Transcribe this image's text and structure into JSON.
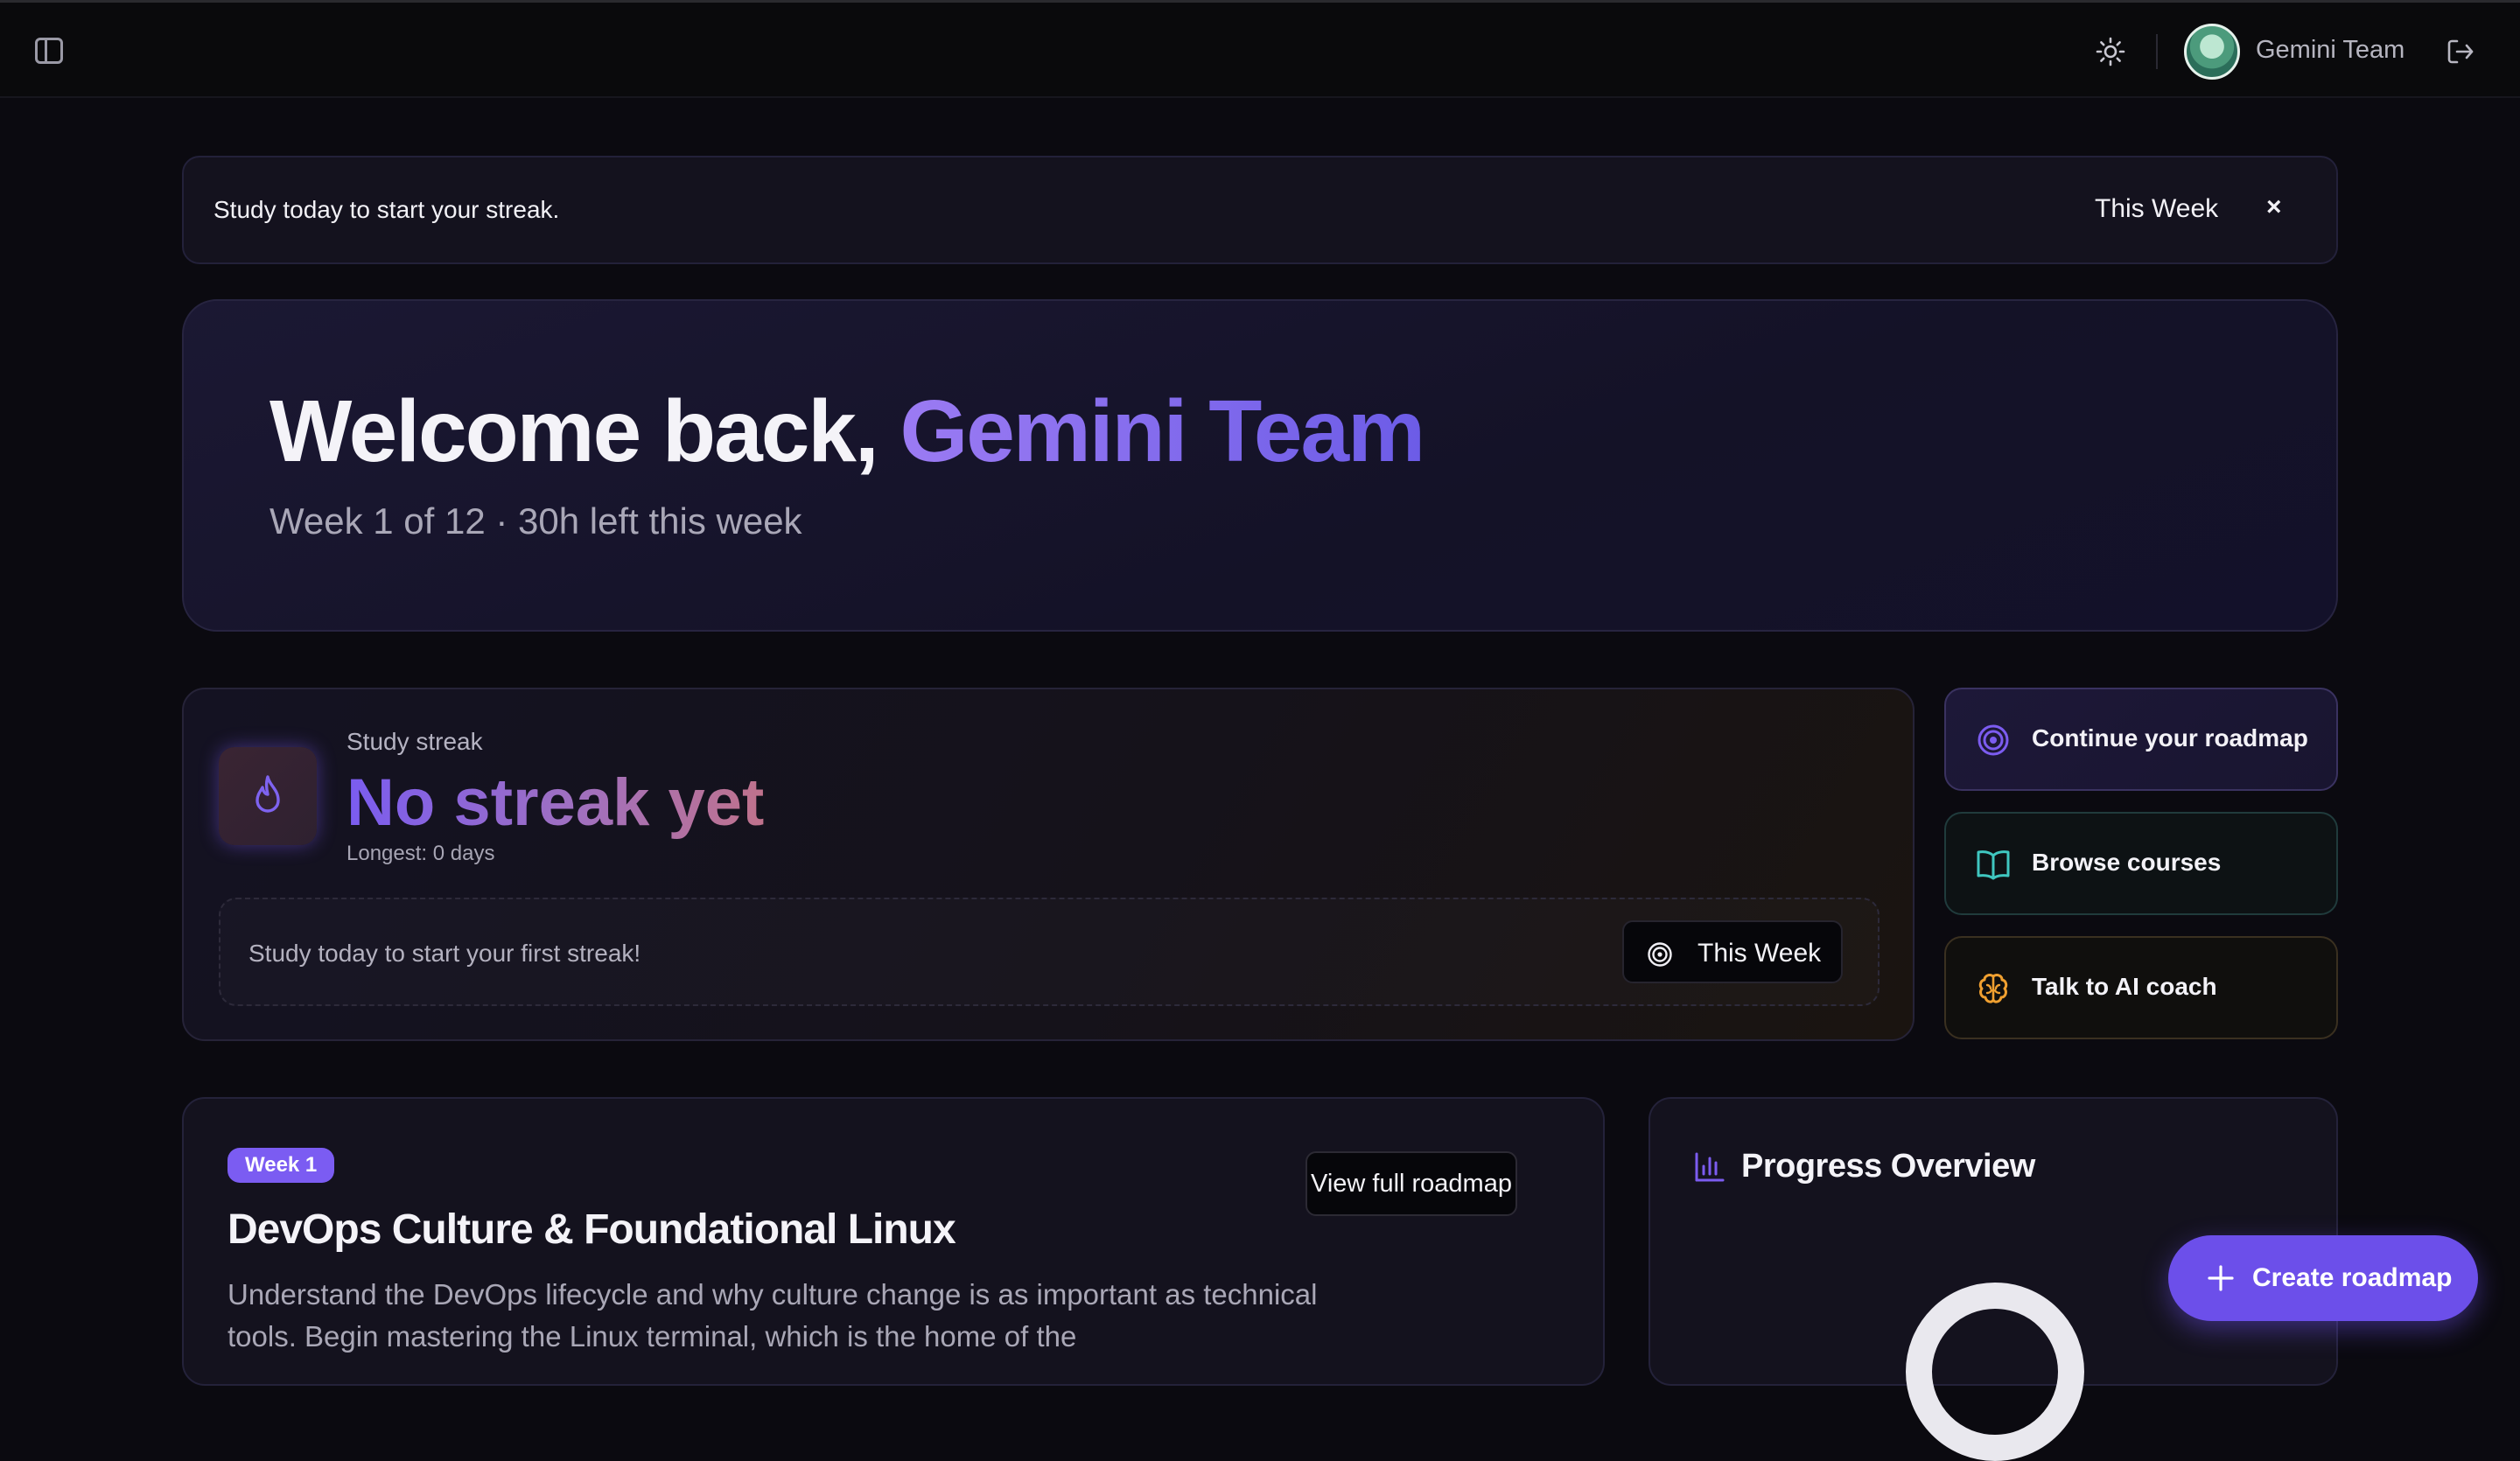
{
  "header": {
    "user_name": "Gemini Team"
  },
  "banner": {
    "message": "Study today to start your streak.",
    "week_label": "This Week",
    "close_symbol": "×"
  },
  "hero": {
    "greeting": "Welcome back, ",
    "name": "Gemini Team",
    "subtitle": "Week 1 of 12 · 30h left this week"
  },
  "streak": {
    "label": "Study streak",
    "value": "No streak yet",
    "longest": "Longest: 0 days",
    "prompt": "Study today to start your first streak!",
    "week_button": "This Week"
  },
  "actions": [
    {
      "label": "Continue your roadmap",
      "icon": "target-icon",
      "color": "#7c5cf0"
    },
    {
      "label": "Browse courses",
      "icon": "book-open-icon",
      "color": "#3fc7c0"
    },
    {
      "label": "Talk to AI coach",
      "icon": "brain-icon",
      "color": "#f0a030"
    }
  ],
  "week_card": {
    "badge": "Week 1",
    "view_button": "View full roadmap",
    "title": "DevOps Culture & Foundational Linux",
    "description": "Understand the DevOps lifecycle and why culture change is as important as technical tools. Begin mastering the Linux terminal, which is the home of the"
  },
  "progress": {
    "title": "Progress Overview"
  },
  "fab": {
    "label": "Create roadmap"
  },
  "colors": {
    "accent": "#7b5cf2",
    "background": "#0b0a10"
  }
}
